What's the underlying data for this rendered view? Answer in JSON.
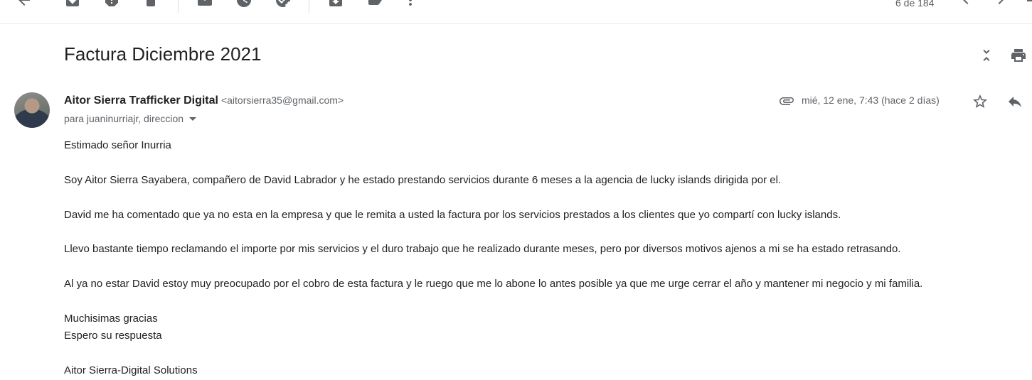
{
  "toolbar": {
    "page_count": "6 de 184",
    "icons": [
      "back-arrow-icon",
      "archive-icon",
      "report-spam-icon",
      "delete-icon",
      "mark-unread-icon",
      "snooze-icon",
      "add-task-icon",
      "move-to-icon",
      "label-icon",
      "more-vert-icon",
      "chevron-left-icon",
      "chevron-right-icon"
    ]
  },
  "email": {
    "subject": "Factura Diciembre 2021",
    "sender_name": "Aitor Sierra Trafficker Digital",
    "sender_email": "<aitorsierra35@gmail.com>",
    "recipients": "para juaninurriajr, direccion",
    "date": "mié, 12 ene, 7:43 (hace 2 días)",
    "body": {
      "greeting": "Estimado señor Inurria",
      "p1": "Soy Aitor Sierra Sayabera, compañero de David Labrador y he estado prestando servicios durante 6 meses a la agencia de lucky islands dirigida por el.",
      "p2": "David me ha comentado que ya no esta en la empresa y que le remita a usted la factura por los servicios prestados a los clientes que yo compartí con lucky islands.",
      "p3": "Llevo bastante tiempo reclamando el importe por mis servicios y el duro trabajo que he realizado durante meses, pero por diversos motivos ajenos a mi se ha estado retrasando.",
      "p4": "Al ya no estar David estoy muy preocupado por el cobro de esta factura y le ruego que me lo abone lo antes posible ya que me urge cerrar el año y mantener mi negocio y mi familia.",
      "closing1": "Muchisimas gracias",
      "closing2": "Espero su respuesta",
      "signature": "Aitor Sierra-Digital Solutions"
    }
  }
}
